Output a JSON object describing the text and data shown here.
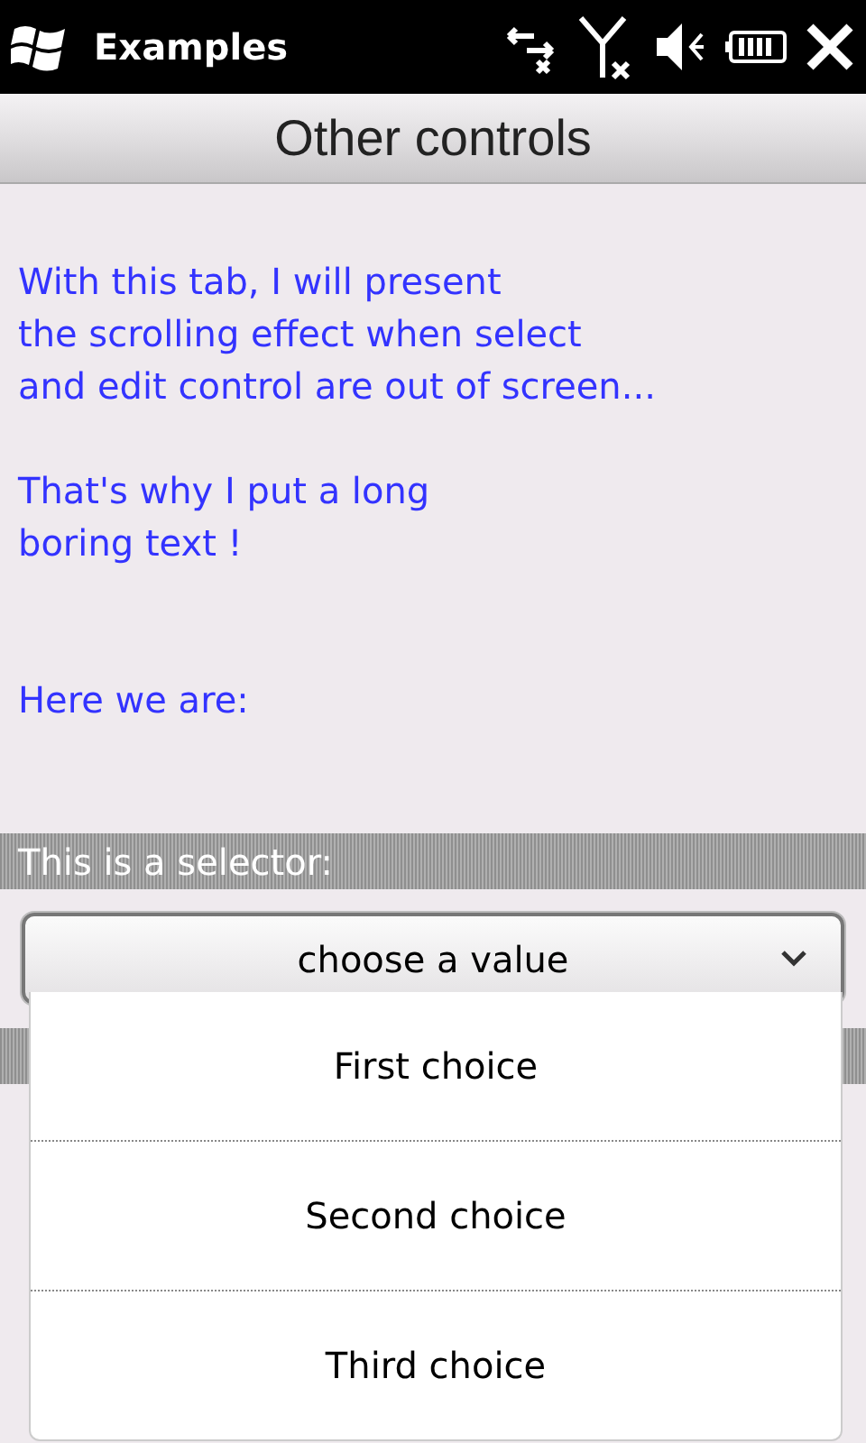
{
  "status_bar": {
    "title": "Examples"
  },
  "header": {
    "title": "Other controls"
  },
  "paragraphs": [
    "With this tab, I will present\nthe scrolling effect when select\nand edit control are out of screen...",
    "That's why I put a long\nboring text !",
    "Here we are:"
  ],
  "selector_section": {
    "label": "This is a selector:",
    "select": {
      "value": "choose a value",
      "expanded": true,
      "options": [
        {
          "label": "First choice",
          "selected": false
        },
        {
          "label": "Second choice",
          "selected": false
        },
        {
          "label": "Third choice",
          "selected": false
        }
      ]
    }
  }
}
